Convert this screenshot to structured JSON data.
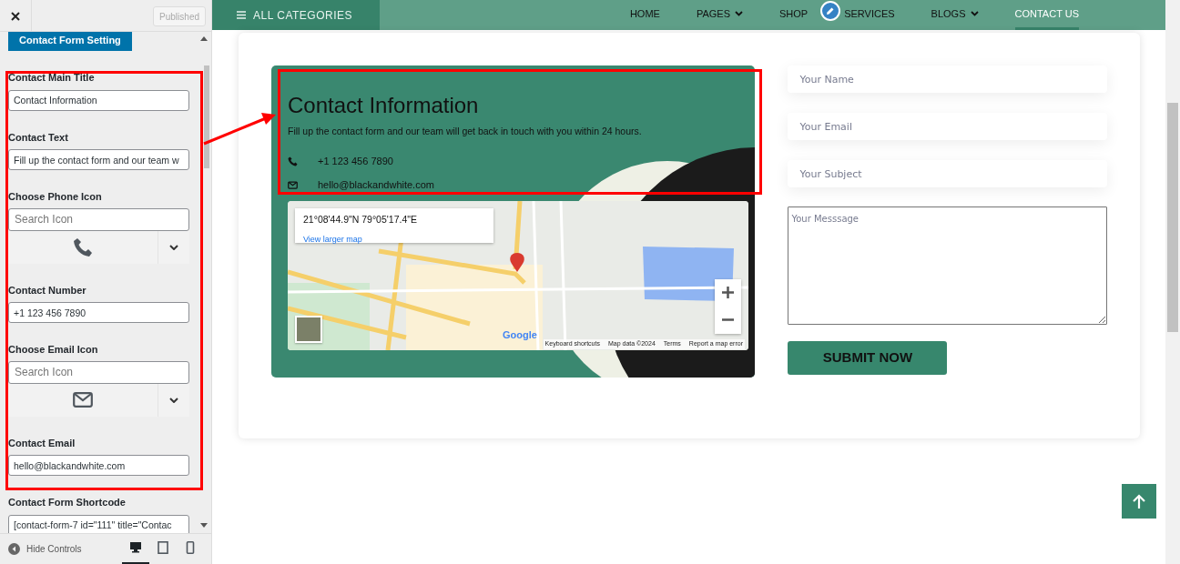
{
  "sidebar": {
    "publish_button": {
      "label": "Published",
      "disabled": true
    },
    "section_title": "Contact Form Setting",
    "fields": [
      {
        "kind": "text",
        "label": "Contact Main Title",
        "value": "Contact Information"
      },
      {
        "kind": "text",
        "label": "Contact Text",
        "value": "Fill up the contact form and our team w"
      },
      {
        "kind": "icon_picker",
        "label": "Choose Phone Icon",
        "placeholder": "Search Icon"
      },
      {
        "kind": "text",
        "label": "Contact Number",
        "value": "+1 123 456 7890"
      },
      {
        "kind": "icon_picker",
        "label": "Choose Email Icon",
        "placeholder": "Search Icon"
      },
      {
        "kind": "text",
        "label": "Contact Email",
        "value": "hello@blackandwhite.com"
      },
      {
        "kind": "text",
        "label": "Contact Form Shortcode",
        "value": "[contact-form-7 id=\"111\" title=\"Contac"
      }
    ],
    "hide_controls": "Hide Controls",
    "devices": [
      {
        "selected": true
      },
      {
        "selected": false
      },
      {
        "selected": false
      }
    ]
  },
  "navbar": {
    "categories": "ALL CATEGORIES",
    "items": [
      {
        "label": "HOME",
        "dropdown": false,
        "selected": false
      },
      {
        "label": "PAGES",
        "dropdown": true,
        "selected": false
      },
      {
        "label": "SHOP",
        "dropdown": false,
        "selected": false
      },
      {
        "label": "SERVICES",
        "dropdown": false,
        "selected": false
      },
      {
        "label": "BLOGS",
        "dropdown": true,
        "selected": false
      },
      {
        "label": "CONTACT US",
        "dropdown": false,
        "selected": true
      }
    ]
  },
  "contact": {
    "title": "Contact Information",
    "text": "Fill up the contact form and our team will get back in touch with you within 24 hours.",
    "items": [
      "+1 123 456 7890",
      "hello@blackandwhite.com"
    ],
    "map": {
      "coordinates": "21°08'44.9\"N 79°05'17.4\"E",
      "larger_map_link": "View larger map",
      "logo": "Google",
      "footer": [
        "Keyboard shortcuts",
        "Map data ©2024",
        "Terms",
        "Report a map error"
      ]
    }
  },
  "form": {
    "fields": [
      {
        "placeholder": "Your Name"
      },
      {
        "placeholder": "Your Email"
      },
      {
        "placeholder": "Your Subject"
      }
    ],
    "message": {
      "placeholder": "Your Messsage"
    },
    "submit": "SUBMIT NOW"
  }
}
